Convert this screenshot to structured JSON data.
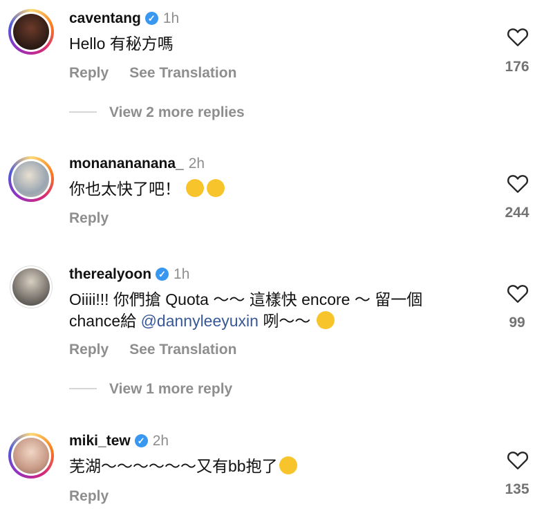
{
  "comments": [
    {
      "username": "caventang",
      "verified": true,
      "time": "1h",
      "text": "Hello 有秘方嗎",
      "actions": [
        "Reply",
        "See Translation"
      ],
      "likes": "176",
      "more_replies": "View 2 more replies"
    },
    {
      "username": "monanananana_",
      "verified": false,
      "time": "2h",
      "text": "你也太快了吧！",
      "emojis": [
        "rolling-laughing-emoji",
        "rolling-laughing-emoji"
      ],
      "actions": [
        "Reply"
      ],
      "likes": "244"
    },
    {
      "username": "therealyoon",
      "verified": true,
      "time": "1h",
      "text_line1": "Oiiii!!! 你們搶 Quota ～～ 這樣快 encore ～ 留一個",
      "text_line2_pre": "chance給 ",
      "mention": "@dannyleeyuxin",
      "text_line2_post": " 咧～～",
      "emojis": [
        "hand-over-mouth-emoji"
      ],
      "actions": [
        "Reply",
        "See Translation"
      ],
      "likes": "99",
      "more_replies": "View 1 more reply"
    },
    {
      "username": "miki_tew",
      "verified": true,
      "time": "2h",
      "text": "芜湖～～～～～～又有bb抱了",
      "emojis": [
        "grinning-squinting-emoji"
      ],
      "actions": [
        "Reply"
      ],
      "likes": "135"
    }
  ],
  "colors": {
    "text": "#111111",
    "secondary": "#8e8e8e",
    "verified": "#3897f0",
    "mention": "#385898"
  }
}
